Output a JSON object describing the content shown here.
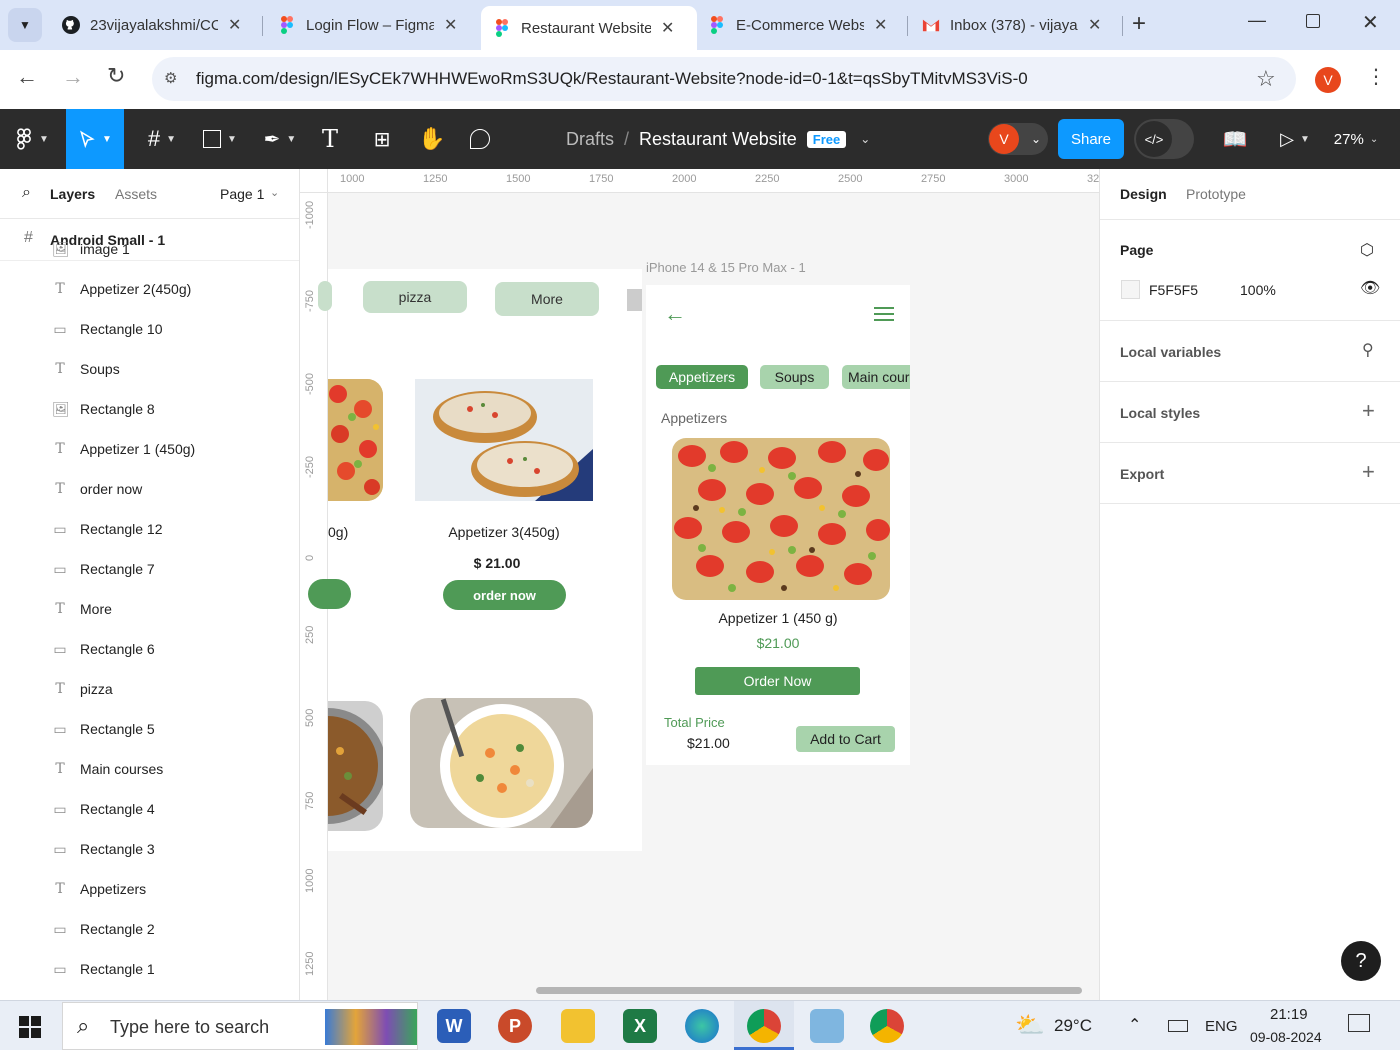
{
  "browser": {
    "tabs": [
      {
        "title": "23vijayalakshmi/CC",
        "icon": "github-icon"
      },
      {
        "title": "Login Flow – Figma",
        "icon": "figma-icon"
      },
      {
        "title": "Restaurant Website",
        "icon": "figma-icon",
        "active": true
      },
      {
        "title": "E-Commerce Website",
        "icon": "figma-icon"
      },
      {
        "title": "Inbox (378) - vijaya",
        "icon": "gmail-icon"
      }
    ],
    "url": "figma.com/design/lESyCEk7WHHWEwoRmS3UQk/Restaurant-Website?node-id=0-1&t=qsSbyTMitvMS3ViS-0",
    "profile_initial": "V"
  },
  "figma_toolbar": {
    "breadcrumb_parent": "Drafts",
    "breadcrumb_sep": "/",
    "file_name": "Restaurant Website",
    "plan_badge": "Free",
    "avatar_initial": "V",
    "share_label": "Share",
    "zoom": "27%"
  },
  "left_panel": {
    "tabs": [
      "Layers",
      "Assets"
    ],
    "page_selector": "Page 1",
    "frame_name": "Android Small - 1",
    "layers": [
      {
        "name": "image 1",
        "icon": "image-icon"
      },
      {
        "name": "Appetizer 2(450g)",
        "icon": "text-icon"
      },
      {
        "name": "Rectangle 10",
        "icon": "rectangle-icon"
      },
      {
        "name": "Soups",
        "icon": "text-icon"
      },
      {
        "name": "Rectangle 8",
        "icon": "image-icon"
      },
      {
        "name": "Appetizer 1 (450g)",
        "icon": "text-icon"
      },
      {
        "name": "order now",
        "icon": "text-icon"
      },
      {
        "name": "Rectangle 12",
        "icon": "rectangle-icon"
      },
      {
        "name": "Rectangle 7",
        "icon": "rectangle-icon"
      },
      {
        "name": "More",
        "icon": "text-icon"
      },
      {
        "name": "Rectangle 6",
        "icon": "rectangle-icon"
      },
      {
        "name": "pizza",
        "icon": "text-icon"
      },
      {
        "name": "Rectangle 5",
        "icon": "rectangle-icon"
      },
      {
        "name": "Main courses",
        "icon": "text-icon"
      },
      {
        "name": "Rectangle 4",
        "icon": "rectangle-icon"
      },
      {
        "name": "Rectangle 3",
        "icon": "rectangle-icon"
      },
      {
        "name": "Appetizers",
        "icon": "text-icon"
      },
      {
        "name": "Rectangle 2",
        "icon": "rectangle-icon"
      },
      {
        "name": "Rectangle 1",
        "icon": "rectangle-icon"
      }
    ]
  },
  "rulers": {
    "horizontal": [
      "1000",
      "1250",
      "1500",
      "1750",
      "2000",
      "2250",
      "2500",
      "2750",
      "3000",
      "32"
    ],
    "vertical": [
      "-1000",
      "-750",
      "-500",
      "-250",
      "0",
      "250",
      "500",
      "750",
      "1000",
      "1250"
    ]
  },
  "canvas": {
    "android_frame": {
      "category_chips": [
        "pizza",
        "More"
      ],
      "product_partial_label": "0g)",
      "product_name": "Appetizer 3(450g)",
      "product_price": "$ 21.00",
      "order_button": "order now"
    },
    "iphone_frame": {
      "frame_label_light": "iPhone 14 & 15 Pro Max - 1",
      "tabs": [
        "Appetizers",
        "Soups",
        "Main cour"
      ],
      "section_title": "Appetizers",
      "item_name": "Appetizer 1 (450 g)",
      "item_price": "$21.00",
      "order_button": "Order Now",
      "total_label": "Total Price",
      "total_value": "$21.00",
      "cart_button": "Add to Cart"
    }
  },
  "right_panel": {
    "tabs": [
      "Design",
      "Prototype"
    ],
    "page_title": "Page",
    "page_color": "F5F5F5",
    "page_opacity": "100%",
    "local_variables": "Local variables",
    "local_styles": "Local styles",
    "export": "Export",
    "help": "?"
  },
  "taskbar": {
    "search_placeholder": "Type here to search",
    "weather_temp": "29°C",
    "language": "ENG",
    "time": "21:19",
    "date": "09-08-2024"
  },
  "colors": {
    "figma_blue": "#0d99ff",
    "green_primary": "#4f9a56",
    "green_light": "#c8dfcb",
    "toolbar_bg": "#2c2c2c"
  }
}
